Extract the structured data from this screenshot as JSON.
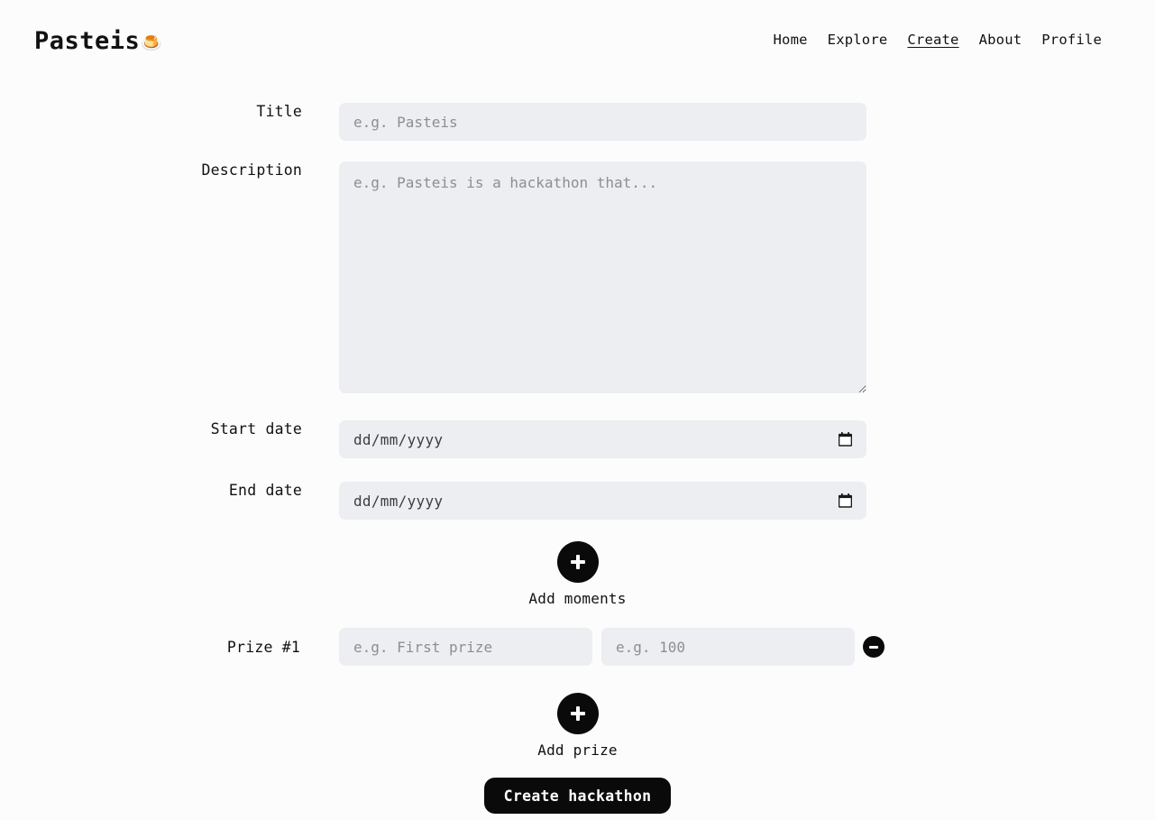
{
  "brand": {
    "name": "Pasteis",
    "emoji": "🍮"
  },
  "nav": {
    "items": [
      {
        "label": "Home",
        "active": false
      },
      {
        "label": "Explore",
        "active": false
      },
      {
        "label": "Create",
        "active": true
      },
      {
        "label": "About",
        "active": false
      },
      {
        "label": "Profile",
        "active": false
      }
    ]
  },
  "form": {
    "title": {
      "label": "Title",
      "placeholder": "e.g. Pasteis",
      "value": ""
    },
    "description": {
      "label": "Description",
      "placeholder": "e.g. Pasteis is a hackathon that...",
      "value": ""
    },
    "start_date": {
      "label": "Start date",
      "placeholder": "dd/mm/yyyy",
      "value": ""
    },
    "end_date": {
      "label": "End date",
      "placeholder": "dd/mm/yyyy",
      "value": ""
    },
    "add_moments": {
      "label": "Add moments",
      "icon": "plus-icon"
    },
    "prizes": [
      {
        "label": "Prize #1",
        "name_placeholder": "e.g. First prize",
        "name_value": "",
        "amount_placeholder": "e.g. 100",
        "amount_value": "",
        "remove_icon": "minus-icon"
      }
    ],
    "add_prize": {
      "label": "Add prize",
      "icon": "plus-icon"
    },
    "submit": {
      "label": "Create hackathon"
    }
  },
  "colors": {
    "page_background": "#fcfcfc",
    "input_background": "#eceef1",
    "text": "#111111",
    "placeholder": "#8b8f94",
    "accent_dark": "#0a0a0a",
    "on_accent": "#ffffff"
  }
}
